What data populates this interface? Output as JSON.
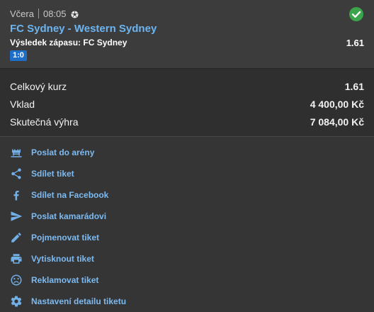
{
  "ticket": {
    "day": "Včera",
    "time": "08:05",
    "sport_icon": "soccer-ball-icon",
    "status_icon": "check-circle-icon",
    "match": "FC Sydney - Western Sydney",
    "bet_label": "Výsledek zápasu: FC Sydney",
    "bet_odds": "1.61",
    "score": "1:0"
  },
  "summary": {
    "total_odds_label": "Celkový kurz",
    "total_odds_value": "1.61",
    "stake_label": "Vklad",
    "stake_value": "4 400,00 Kč",
    "win_label": "Skutečná výhra",
    "win_value": "7 084,00 Kč"
  },
  "actions": [
    {
      "label": "Poslat do arény",
      "icon": "arena-icon"
    },
    {
      "label": "Sdílet tiket",
      "icon": "share-icon"
    },
    {
      "label": "Sdílet na Facebook",
      "icon": "facebook-icon"
    },
    {
      "label": "Poslat kamarádovi",
      "icon": "send-icon"
    },
    {
      "label": "Pojmenovat tiket",
      "icon": "pencil-icon"
    },
    {
      "label": "Vytisknout tiket",
      "icon": "printer-icon"
    },
    {
      "label": "Reklamovat tiket",
      "icon": "sad-face-icon"
    },
    {
      "label": "Nastavení detailu tiketu",
      "icon": "gear-icon"
    }
  ],
  "colors": {
    "accent_blue": "#6cb4f0",
    "success_green": "#3aa54a",
    "badge_blue": "#1e6ec8"
  }
}
